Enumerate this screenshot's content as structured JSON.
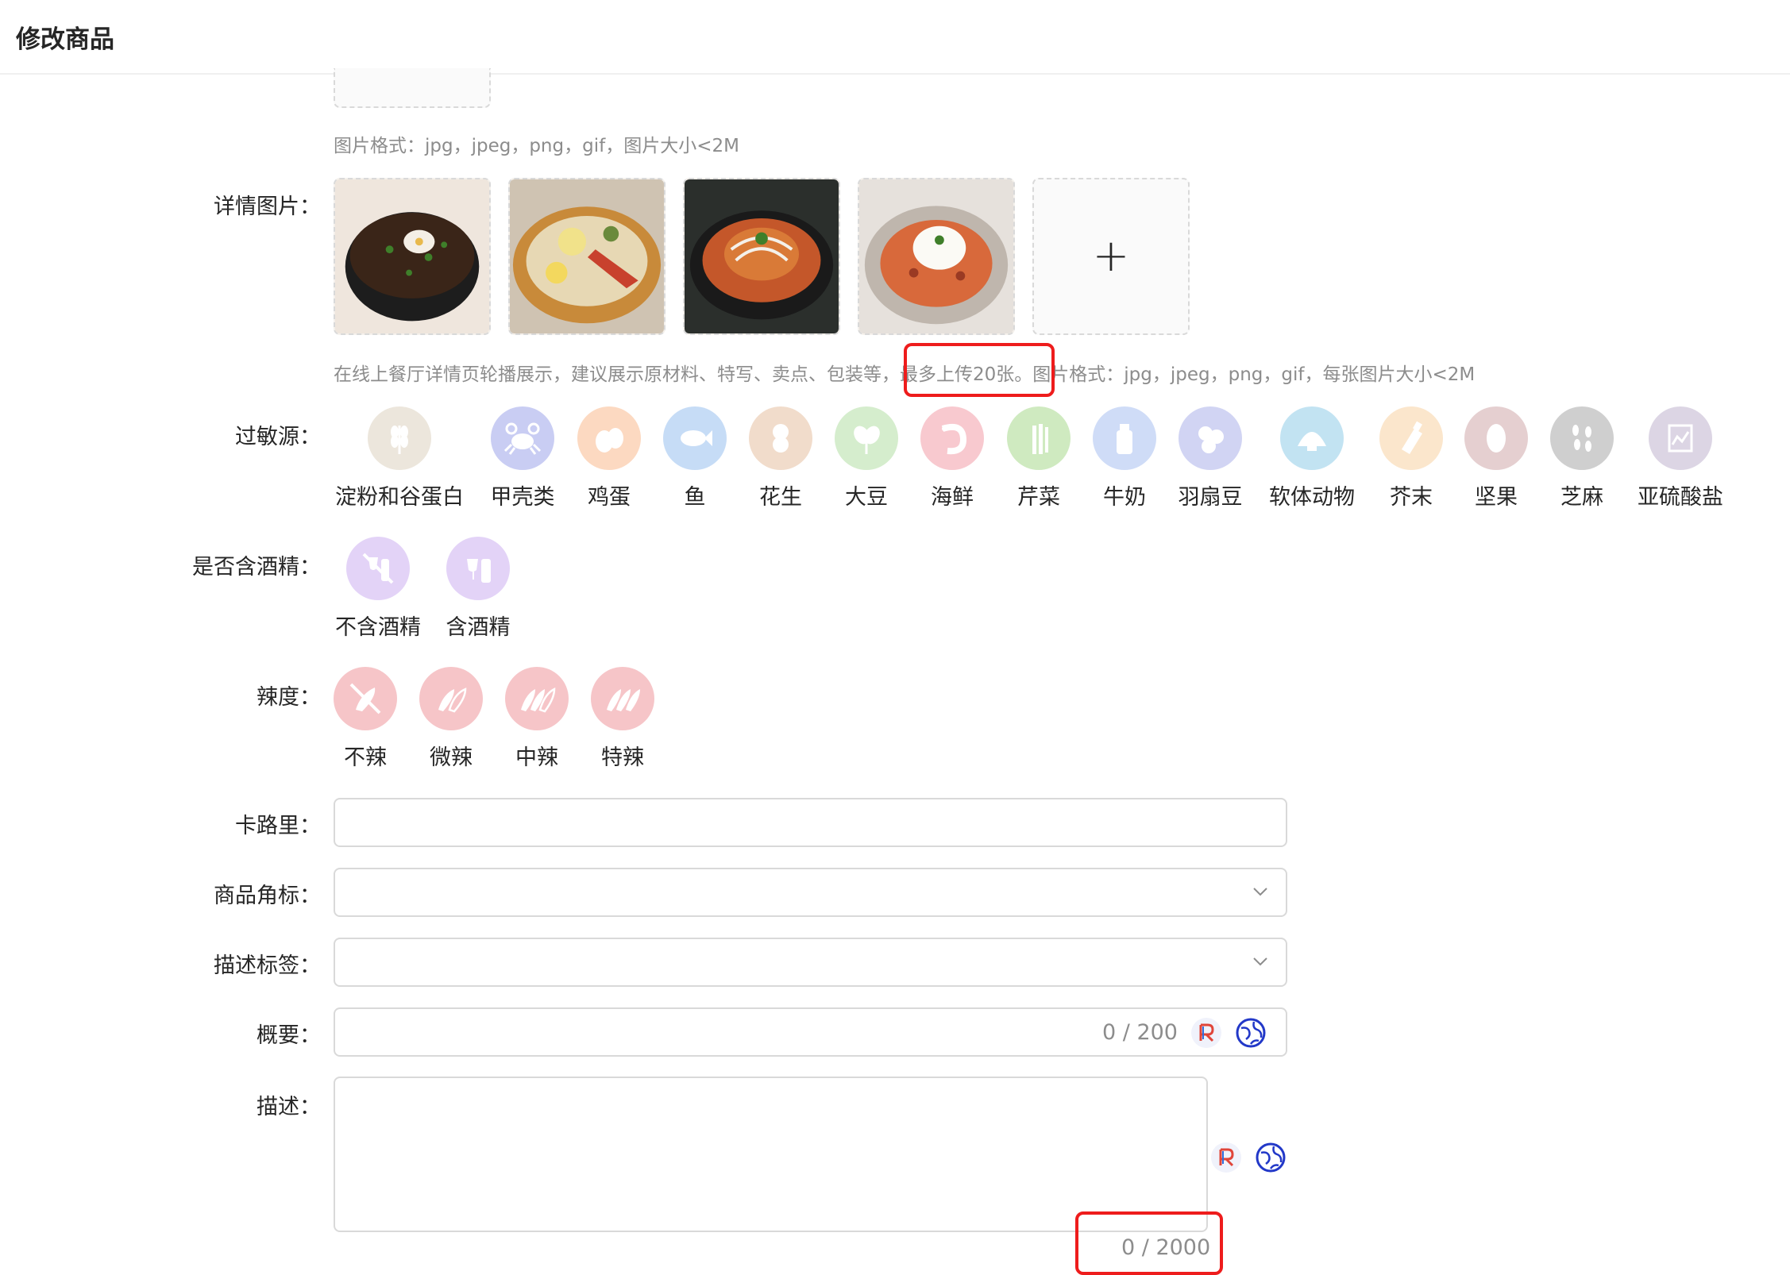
{
  "header": {
    "title": "修改商品"
  },
  "main_image": {
    "hint": "图片格式：jpg，jpeg，png，gif，图片大小<2M"
  },
  "detail_images": {
    "label": "详情图片：",
    "hint_before": "在线上餐厅详情页轮播展示，建议展示原材料、特写、卖点、包装等",
    "hint_highlight": "，最多上传20张。",
    "hint_after": "图片格式：jpg，jpeg，png，gif，每张图片大小<2M",
    "upload_symbol": "+"
  },
  "allergens": {
    "label": "过敏源：",
    "items": [
      {
        "label": "淀粉和谷蛋白",
        "icon": "wheat-icon",
        "color": "#ece6dc"
      },
      {
        "label": "甲壳类",
        "icon": "crab-icon",
        "color": "#c9cdf3"
      },
      {
        "label": "鸡蛋",
        "icon": "egg-icon",
        "color": "#fcd9c1"
      },
      {
        "label": "鱼",
        "icon": "fish-icon",
        "color": "#c6dcf6"
      },
      {
        "label": "花生",
        "icon": "peanut-icon",
        "color": "#f1dccb"
      },
      {
        "label": "大豆",
        "icon": "soybean-icon",
        "color": "#d5edcd"
      },
      {
        "label": "海鲜",
        "icon": "shrimp-icon",
        "color": "#f8c9cf"
      },
      {
        "label": "芹菜",
        "icon": "celery-icon",
        "color": "#cfeac0"
      },
      {
        "label": "牛奶",
        "icon": "milk-icon",
        "color": "#cfdcf7"
      },
      {
        "label": "羽扇豆",
        "icon": "lupin-icon",
        "color": "#d1d4f3"
      },
      {
        "label": "软体动物",
        "icon": "shell-icon",
        "color": "#c2e3f2"
      },
      {
        "label": "芥末",
        "icon": "mustard-icon",
        "color": "#fbe6cc"
      },
      {
        "label": "坚果",
        "icon": "nut-icon",
        "color": "#e5cfd0"
      },
      {
        "label": "芝麻",
        "icon": "sesame-icon",
        "color": "#cfcfcf"
      },
      {
        "label": "亚硫酸盐",
        "icon": "sulfite-icon",
        "color": "#dcd5e4"
      }
    ]
  },
  "alcohol": {
    "label": "是否含酒精：",
    "items": [
      {
        "label": "不含酒精",
        "icon": "no-alcohol-icon",
        "color": "#e3d3f7"
      },
      {
        "label": "含酒精",
        "icon": "alcohol-icon",
        "color": "#e3d3f7"
      }
    ]
  },
  "spiciness": {
    "label": "辣度：",
    "items": [
      {
        "label": "不辣",
        "icon": "not-spicy-icon",
        "color": "#f6c5c8"
      },
      {
        "label": "微辣",
        "icon": "mild-spicy-icon",
        "color": "#f6c5c8"
      },
      {
        "label": "中辣",
        "icon": "medium-spicy-icon",
        "color": "#f6c5c8"
      },
      {
        "label": "特辣",
        "icon": "extra-spicy-icon",
        "color": "#f6c5c8"
      }
    ]
  },
  "calories": {
    "label": "卡路里：",
    "value": ""
  },
  "corner_tag": {
    "label": "商品角标：",
    "value": ""
  },
  "desc_tag": {
    "label": "描述标签：",
    "value": ""
  },
  "summary": {
    "label": "概要：",
    "value": "",
    "counter": "0 / 200"
  },
  "description": {
    "label": "描述：",
    "value": "",
    "counter": "0 / 2000"
  },
  "colors": {
    "highlight_box": "#ee1c1c",
    "border": "#d9d9d9",
    "hint": "#8c8c8c"
  }
}
